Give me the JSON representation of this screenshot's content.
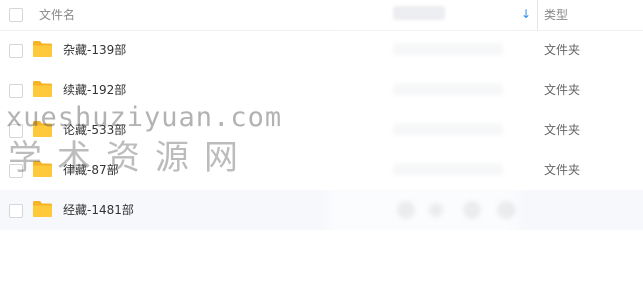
{
  "header": {
    "name_label": "文件名",
    "date_label": "修改日期",
    "sort_icon": "sort-desc-icon",
    "sort_glyph": "↓",
    "type_label": "类型"
  },
  "rows": [
    {
      "name": "杂藏-139部",
      "type": "文件夹",
      "icon": "folder-icon"
    },
    {
      "name": "续藏-192部",
      "type": "文件夹",
      "icon": "folder-icon"
    },
    {
      "name": "论藏-533部",
      "type": "文件夹",
      "icon": "folder-icon"
    },
    {
      "name": "律藏-87部",
      "type": "文件夹",
      "icon": "folder-icon"
    },
    {
      "name": "经藏-1481部",
      "type": "",
      "icon": "folder-icon",
      "hovered": true
    }
  ],
  "watermark": {
    "latin": "xueshuziyuan.com",
    "cjk": "学术资源网"
  },
  "colors": {
    "folder": "#ffc93c",
    "folder_tab": "#f5b325",
    "accent": "#2b8cf0",
    "row_hover": "#f7f8fb"
  }
}
